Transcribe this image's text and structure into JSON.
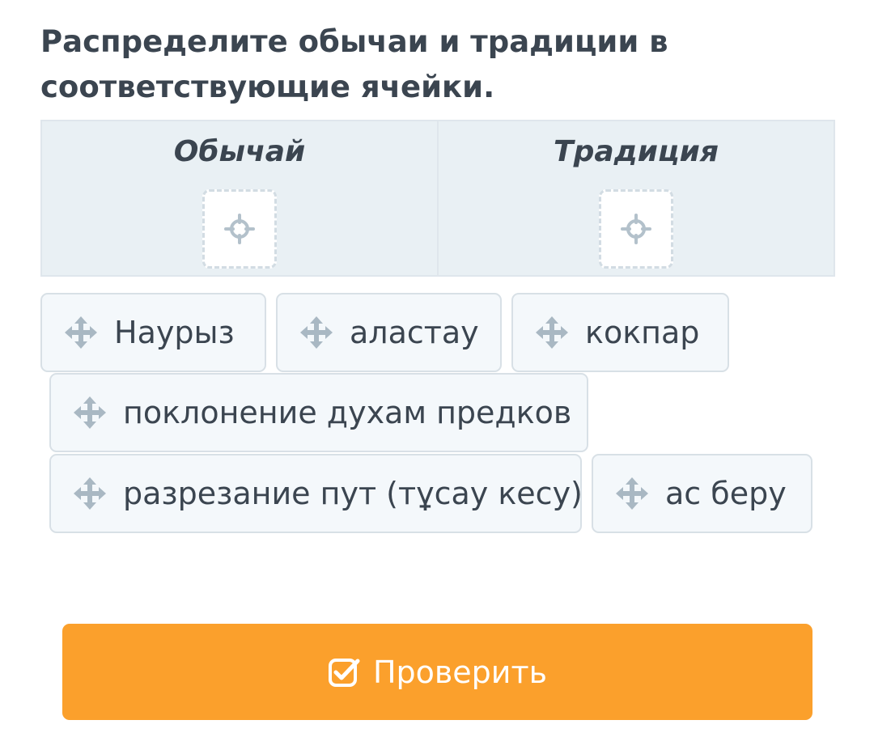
{
  "question": {
    "text": "Распределите обычаи и традиции в соответствующие ячейки."
  },
  "table": {
    "columns": [
      {
        "title": "Обычай",
        "dropzone_icon": "crosshair-icon"
      },
      {
        "title": "Традиция",
        "dropzone_icon": "crosshair-icon"
      }
    ]
  },
  "items": [
    {
      "label": "Наурыз",
      "icon": "move-icon"
    },
    {
      "label": "аластау",
      "icon": "move-icon"
    },
    {
      "label": "кокпар",
      "icon": "move-icon"
    },
    {
      "label": "поклонение духам предков",
      "icon": "move-icon"
    },
    {
      "label": "разрезание пут (тұсау кесу)",
      "icon": "move-icon"
    },
    {
      "label": "ас беру",
      "icon": "move-icon"
    }
  ],
  "check_button": {
    "label": "Проверить",
    "icon": "checkbox-check-icon"
  },
  "colors": {
    "accent": "#fba02c",
    "text": "#3b4550",
    "table_bg": "#e9f0f4",
    "chip_bg": "#f4f8fb",
    "icon": "#a9b8c3"
  }
}
